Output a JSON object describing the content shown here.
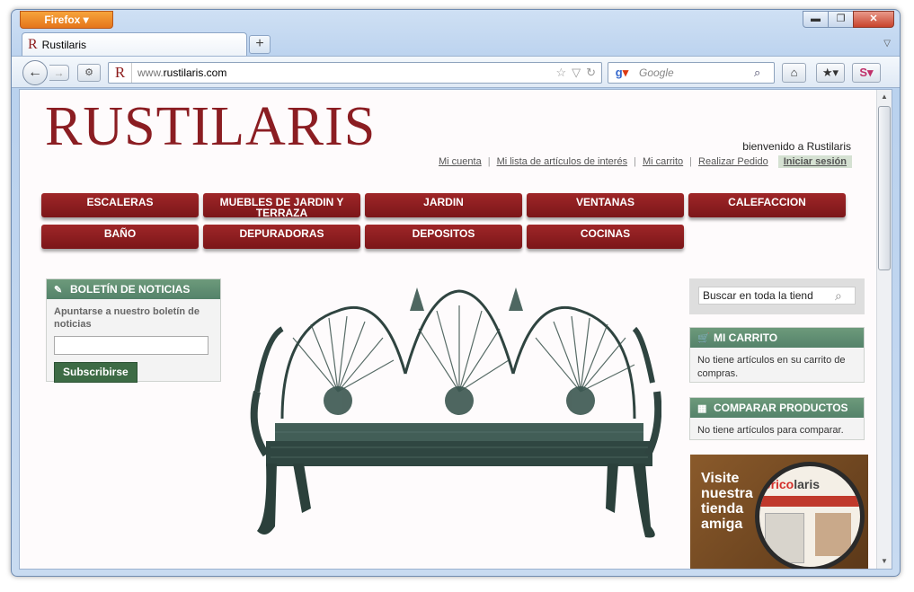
{
  "browser": {
    "app_button": "Firefox",
    "tab_title": "Rustilaris",
    "url_prefix": "www.",
    "url_domain": "rustilaris.com",
    "search_placeholder": "Google",
    "icons": [
      "back-arrow-icon",
      "forward-arrow-icon",
      "star-icon",
      "reload-icon",
      "home-icon",
      "bookmarks-icon",
      "addon-s-icon"
    ]
  },
  "site": {
    "logo": "RUSTILARIS",
    "welcome": "bienvenido a Rustilaris",
    "top_links": [
      "Mi cuenta",
      "Mi lista de artículos de interés",
      "Mi carrito",
      "Realizar Pedido"
    ],
    "login": "Iniciar sesión",
    "menu": [
      "ESCALERAS",
      "MUEBLES DE JARDIN Y TERRAZA",
      "JARDIN",
      "VENTANAS",
      "CALEFACCION",
      "BAÑO",
      "DEPURADORAS",
      "DEPOSITOS",
      "COCINAS"
    ],
    "newsletter": {
      "title": "BOLETÍN DE NOTICIAS",
      "label": "Apuntarse a nuestro boletín de noticias",
      "button": "Subscribirse"
    },
    "search": {
      "value": "Buscar en toda la tiend"
    },
    "cart": {
      "title": "MI CARRITO",
      "text": "No tiene artículos en su carrito de compras."
    },
    "compare": {
      "title": "COMPARAR PRODUCTOS",
      "text": "No tiene artículos para comparar."
    },
    "banner": {
      "line1": "Visite",
      "line2": "nuestra",
      "line3": "tienda",
      "line4": "amiga",
      "brand_prefix": "b",
      "brand_accent": "rico",
      "brand_suffix": "laris"
    },
    "colors": {
      "brand_red": "#8b1d22",
      "menu_red": "#8f2022",
      "box_header_green": "#5f8c71",
      "subscribe_green": "#3d6b45"
    }
  }
}
